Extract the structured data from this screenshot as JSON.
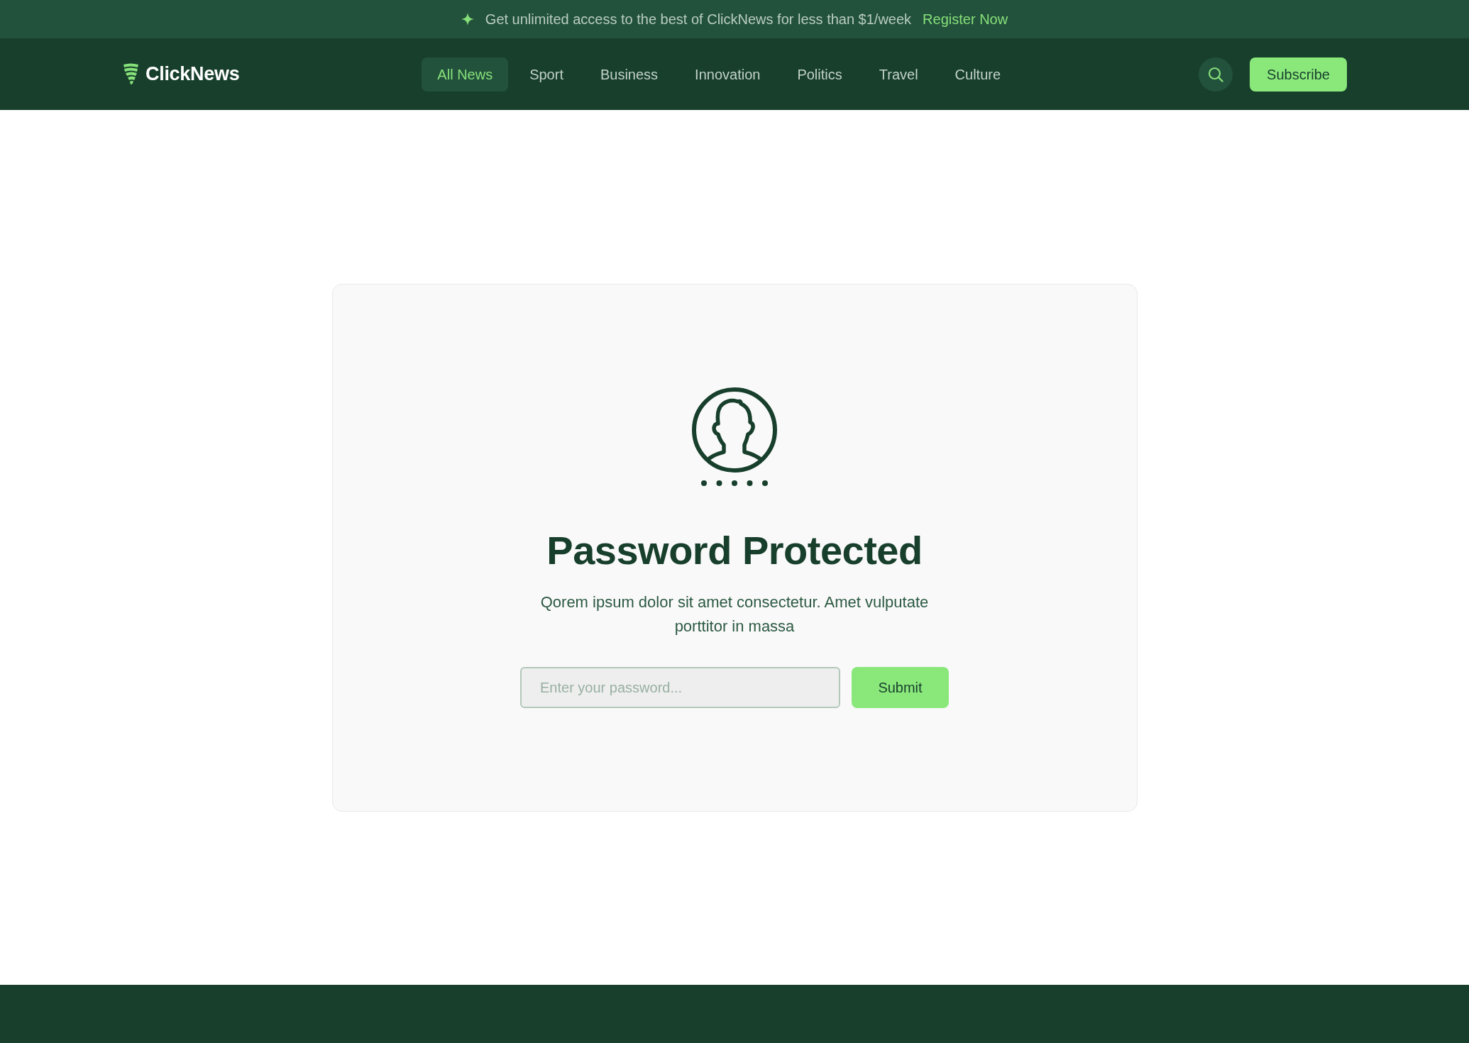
{
  "banner": {
    "text": "Get unlimited access to the best of ClickNews for less than $1/week",
    "link": "Register Now"
  },
  "navbar": {
    "logo": "ClickNews",
    "items": [
      {
        "label": "All News",
        "selected": true
      },
      {
        "label": "Sport",
        "selected": false
      },
      {
        "label": "Business",
        "selected": false
      },
      {
        "label": "Innovation",
        "selected": false
      },
      {
        "label": "Politics",
        "selected": false
      },
      {
        "label": "Travel",
        "selected": false
      },
      {
        "label": "Culture",
        "selected": false
      }
    ],
    "action": "Subscribe"
  },
  "card": {
    "title": "Password Protected",
    "description": "Qorem ipsum dolor sit amet consectetur. Amet vulputate porttitor in massa",
    "password_field": {
      "placeholder": "Enter your password..."
    },
    "submit": "Submit"
  }
}
